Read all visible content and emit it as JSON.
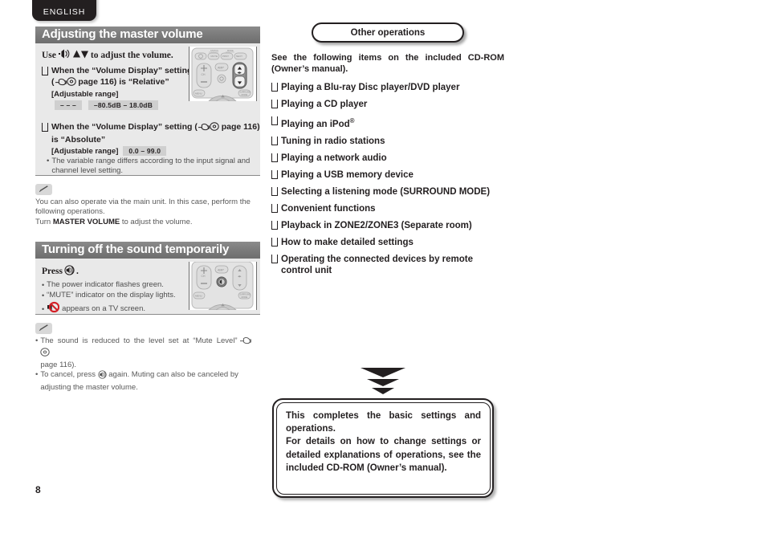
{
  "lang_tab": {
    "label": "ENGLISH"
  },
  "page_number": "8",
  "left_column": {
    "section1": {
      "title": "Adjusting the master volume",
      "use_line_prefix": "Use",
      "use_line_suffix": "to adjust the volume.",
      "icons": [
        "volume-icon",
        "up-down-arrow-icon"
      ],
      "items": [
        {
          "line1_a": "When the “Volume Display” setting",
          "line1_b": "(",
          "ref_icons": [
            "pointing-hand-icon",
            "disc-icon"
          ],
          "line1_c": "page 116) is “Relative”",
          "range_label": "[Adjustable range]",
          "chips": [
            "– – –",
            "–80.5dB – 18.0dB"
          ]
        },
        {
          "line1_a": "When the “Volume Display” setting (",
          "ref_icons": [
            "pointing-hand-icon",
            "disc-icon"
          ],
          "line1_c": "page 116)",
          "line2": "is “Absolute”",
          "range_label": "[Adjustable range]",
          "chips": [
            "0.0 – 99.0"
          ],
          "note": "The variable range differs according to the input signal and channel level setting."
        }
      ],
      "memo": {
        "icon": "pencil-memo-icon",
        "line1": "You can also operate via the main unit. In this case, perform the following operations.",
        "line2_pre": "Turn ",
        "line2_bold": "MASTER VOLUME",
        "line2_post": " to adjust the volume."
      },
      "remote_illustration": "remote-control-volume-diagram"
    },
    "section2": {
      "title": "Turning off the sound temporarily",
      "press_prefix": "Press",
      "press_icon": "mute-button-icon",
      "press_suffix": ".",
      "bullets": [
        {
          "text": "The power indicator flashes green."
        },
        {
          "text": "“MUTE” indicator on the display lights."
        },
        {
          "icon": "mute-crossed-speaker-icon",
          "text": "appears on a TV screen."
        }
      ],
      "memo": {
        "icon": "pencil-memo-icon",
        "bullet1_a": "The sound is reduced to the level set at “Mute Level”",
        "bullet1_icons": [
          "pointing-hand-icon",
          "disc-icon"
        ],
        "bullet1_b": "page 116).",
        "bullet2_a": "To cancel, press",
        "bullet2_icon": "mute-button-icon",
        "bullet2_b": "again. Muting can also be canceled by adjusting the master volume."
      },
      "remote_illustration": "remote-control-mute-diagram"
    }
  },
  "right_column": {
    "badge": "Other operations",
    "intro": "See the following items on the included CD-ROM (Owner’s manual).",
    "operations": [
      {
        "text": "Playing a Blu-ray Disc player/DVD player"
      },
      {
        "text": "Playing a CD player"
      },
      {
        "text": "Playing an iPod",
        "sup": "®"
      },
      {
        "text": "Tuning in radio stations"
      },
      {
        "text": "Playing a network audio"
      },
      {
        "text": "Playing a USB memory device"
      },
      {
        "text": "Selecting a listening mode (SURROUND MODE)"
      },
      {
        "text": "Convenient functions"
      },
      {
        "text": "Playback in ZONE2/ZONE3 (Separate room)"
      },
      {
        "text": "How to make detailed settings"
      },
      {
        "text": "Operating the connected devices by remote control unit"
      }
    ],
    "arrows": "three-down-triangles",
    "final_box": "This completes the basic settings and operations.\nFor details on how to change settings or detailed explanations of operations, see the included CD-ROM (Owner’s manual)."
  },
  "remote_buttons": {
    "top_row": [
      "Ⓢ",
      "MUTE",
      "PRESET",
      "NEXT"
    ],
    "top_labels": [
      "STATUS",
      "MODE"
    ],
    "left_col": [
      "+",
      "CH",
      "−"
    ],
    "center": [
      "AMP",
      "◎"
    ],
    "right_col": [
      "▲",
      "▼"
    ],
    "right_mid": "◂▸",
    "bottom": [
      "MENU",
      "SURROUND MODE"
    ]
  },
  "colors": {
    "header_bar": "#7c7c7c",
    "body_bg": "#e9e9e9",
    "chip_bg": "#cfcfcf",
    "ink": "#231f20",
    "muted_text": "#4d4d4d",
    "mute_red": "#d32027"
  }
}
